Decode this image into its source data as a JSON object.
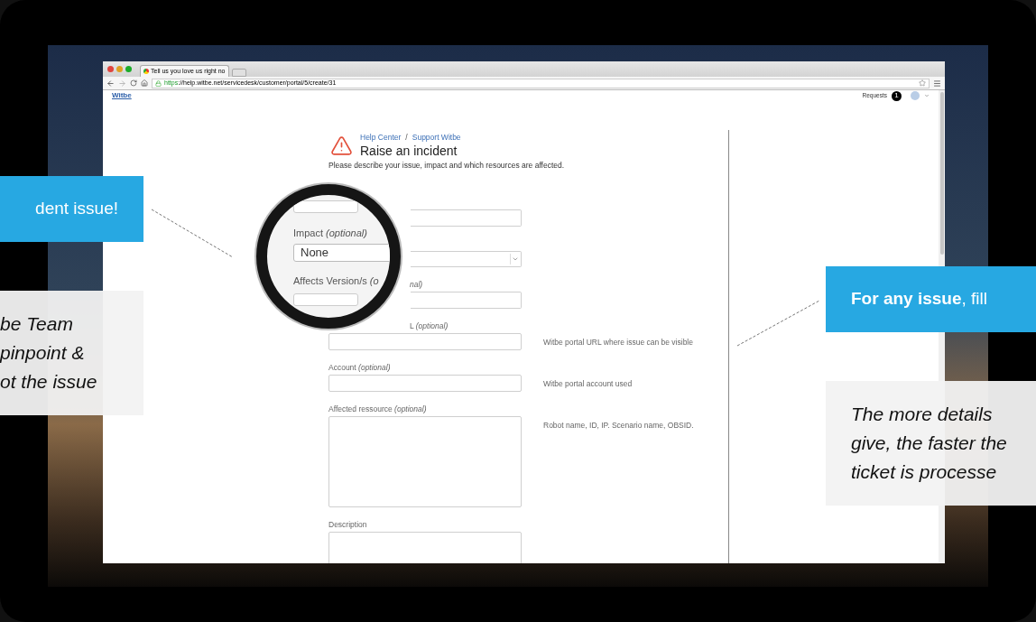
{
  "browser": {
    "tab_title": "Tell us you love us right no",
    "url_scheme": "https",
    "url_rest": "://help.witbe.net/servicedesk/customer/portal/5/create/31"
  },
  "header": {
    "logo": "Witbe",
    "requests_label": "Requests",
    "requests_count": "1"
  },
  "breadcrumbs": [
    "Help Center",
    "Support Witbe"
  ],
  "breadcrumb_separator": "/",
  "title": "Raise an incident",
  "intro": "Please describe your issue, impact and which resources are affected.",
  "fields": [
    {
      "kind": "input",
      "covered": true
    },
    {
      "kind": "select",
      "covered": true
    },
    {
      "kind": "input",
      "covered": true,
      "label": "*nal)*"
    },
    {
      "kind": "input",
      "covered": true,
      "label": "L *(optional)*",
      "help": "Witbe portal URL where issue can be visible"
    },
    {
      "kind": "input",
      "label": "Account *(optional)*",
      "help": "Witbe portal account used"
    },
    {
      "kind": "textarea",
      "label": "Affected ressource *(optional)*",
      "help": "Robot name, ID, IP. Scenario name, OBSID."
    },
    {
      "kind": "textarea",
      "label": "Description"
    }
  ],
  "magnifier": [
    {
      "kind": "input"
    },
    {
      "kind": "label",
      "text": "Impact *(optional)*"
    },
    {
      "kind": "select",
      "value": "None"
    },
    {
      "kind": "label",
      "text": "Affects Version/s *(o*"
    },
    {
      "kind": "input"
    }
  ],
  "callouts": [
    {
      "kind": "left",
      "headline": "dent issue!",
      "body": "be Team\npinpoint &\not the issue"
    },
    {
      "kind": "right",
      "headline": "**For any issue**, fill",
      "body": "The more details\ngive, the faster the\nticket is processe"
    }
  ]
}
